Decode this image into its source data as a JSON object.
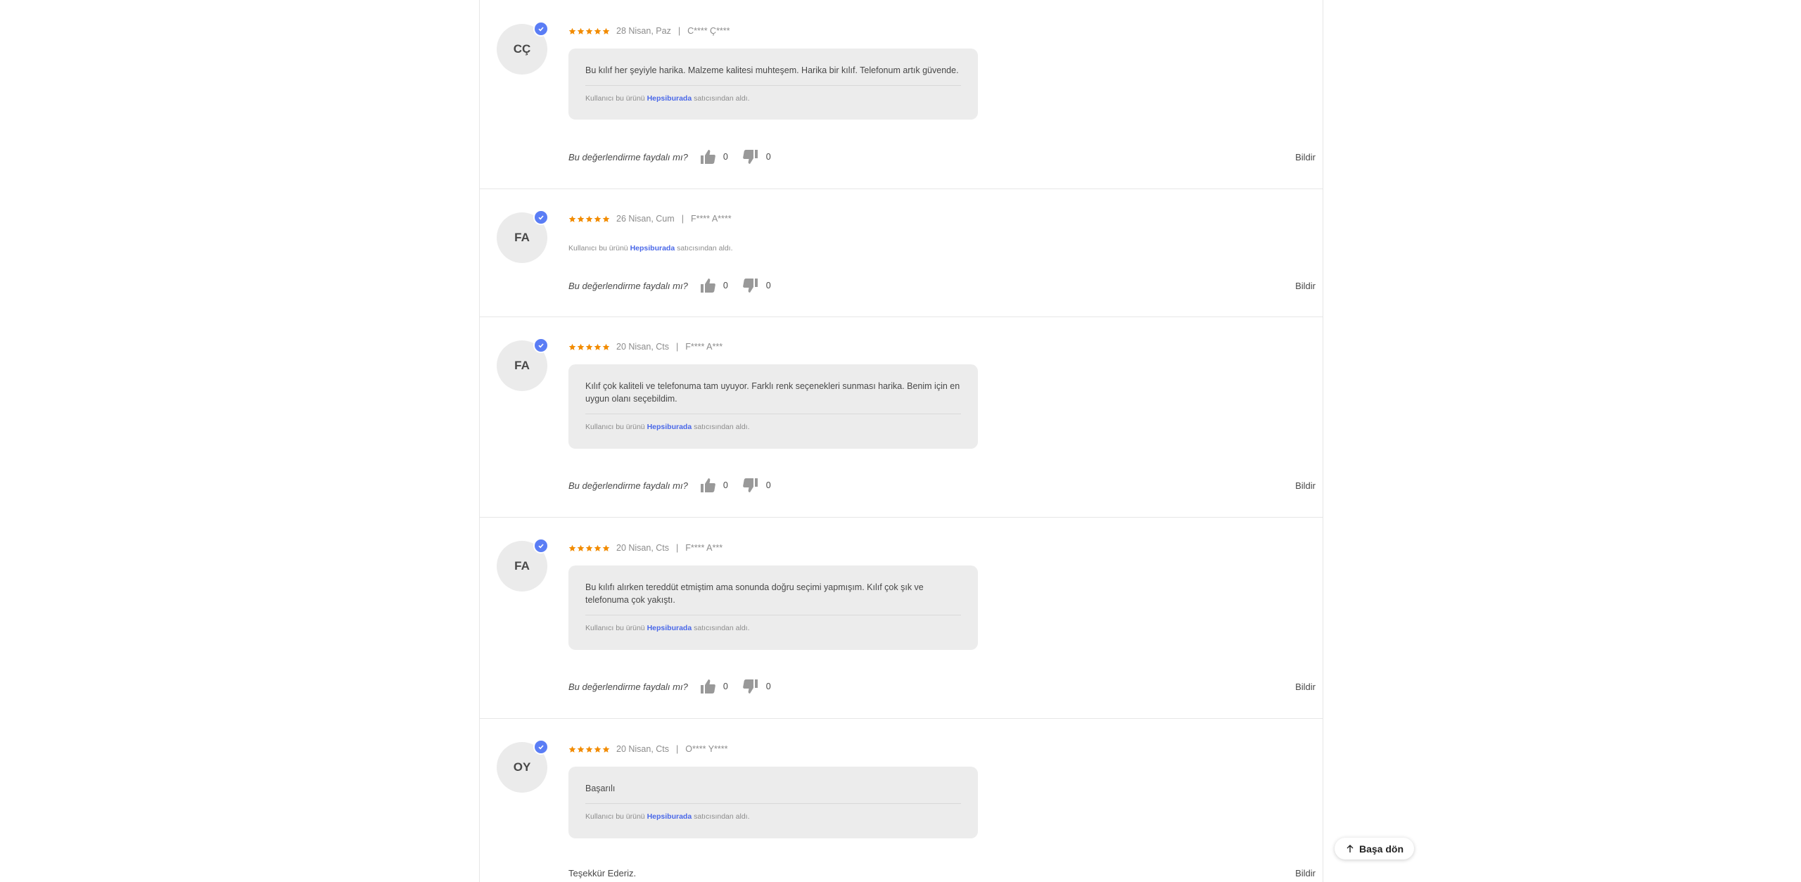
{
  "colors": {
    "star": "#f28b00",
    "badge": "#5a7df5",
    "seller_link": "#4a68e8",
    "bubble": "#ececec"
  },
  "reviews": [
    {
      "initials": "CÇ",
      "rating": 5,
      "date": "28 Nisan, Paz",
      "user": "C**** Ç****",
      "text": "Bu kılıf her şeyiyle harika. Malzeme kalitesi muhteşem. Harika bir kılıf. Telefonum artık güvende.",
      "seller_prefix": "Kullanıcı bu ürünü",
      "seller_name": "Hepsiburada",
      "seller_suffix": "satıcısından aldı.",
      "helpful_question": "Bu değerlendirme faydalı mı?",
      "likes": "0",
      "dislikes": "0",
      "report": "Bildir"
    },
    {
      "initials": "FA",
      "rating": 5,
      "date": "26 Nisan, Cum",
      "user": "F**** A****",
      "text": "",
      "seller_prefix": "Kullanıcı bu ürünü",
      "seller_name": "Hepsiburada",
      "seller_suffix": "satıcısından aldı.",
      "helpful_question": "Bu değerlendirme faydalı mı?",
      "likes": "0",
      "dislikes": "0",
      "report": "Bildir"
    },
    {
      "initials": "FA",
      "rating": 5,
      "date": "20 Nisan, Cts",
      "user": "F**** A***",
      "text": "Kılıf çok kaliteli ve telefonuma tam uyuyor.  Farklı renk seçenekleri sunması harika. Benim için en uygun olanı seçebildim.",
      "seller_prefix": "Kullanıcı bu ürünü",
      "seller_name": "Hepsiburada",
      "seller_suffix": "satıcısından aldı.",
      "helpful_question": "Bu değerlendirme faydalı mı?",
      "likes": "0",
      "dislikes": "0",
      "report": "Bildir"
    },
    {
      "initials": "FA",
      "rating": 5,
      "date": "20 Nisan, Cts",
      "user": "F**** A***",
      "text": "Bu kılıfı alırken tereddüt etmiştim ama sonunda doğru seçimi yapmışım. Kılıf çok şık ve telefonuma çok yakıştı.",
      "seller_prefix": "Kullanıcı bu ürünü",
      "seller_name": "Hepsiburada",
      "seller_suffix": "satıcısından aldı.",
      "helpful_question": "Bu değerlendirme faydalı mı?",
      "likes": "0",
      "dislikes": "0",
      "report": "Bildir"
    },
    {
      "initials": "OY",
      "rating": 5,
      "date": "20 Nisan, Cts",
      "user": "O**** Y****",
      "text": "Başarılı",
      "seller_prefix": "Kullanıcı bu ürünü",
      "seller_name": "Hepsiburada",
      "seller_suffix": "satıcısından aldı."
    }
  ],
  "footer": {
    "thanks": "Teşekkür Ederiz.",
    "report": "Bildir"
  },
  "back_to_top": {
    "label": "Başa dön",
    "icon": "arrow-up-icon"
  }
}
